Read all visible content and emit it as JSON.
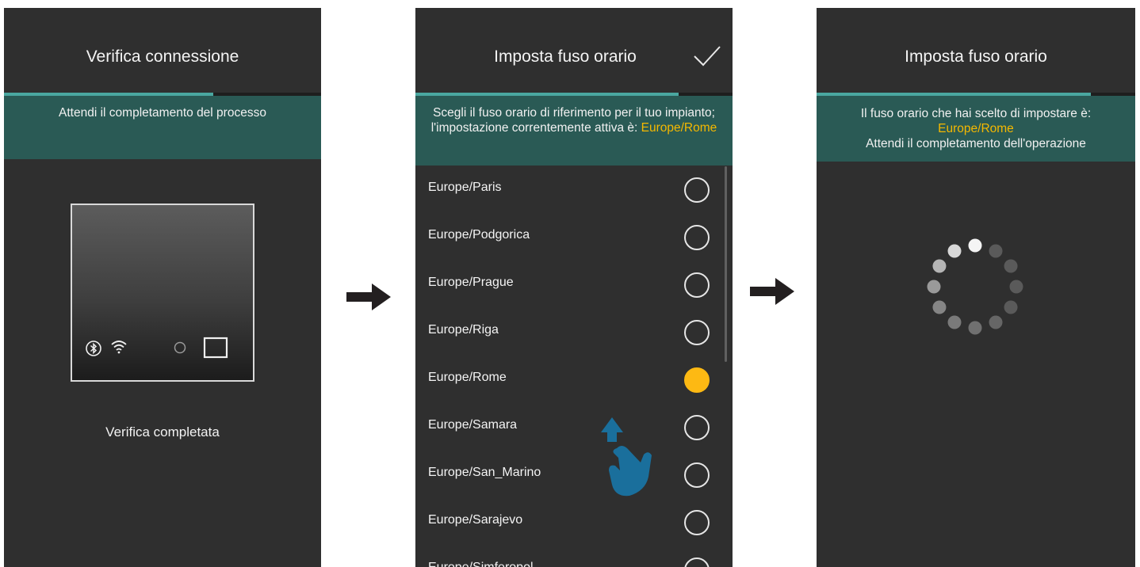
{
  "screen1": {
    "title": "Verifica connessione",
    "progress": 0.66,
    "banner": "Attendi il completamento del processo",
    "device_icons": [
      "bluetooth-icon",
      "wifi-icon",
      "led-dot-icon",
      "square-button-icon"
    ],
    "status": "Verifica completata"
  },
  "screen2": {
    "title": "Imposta fuso orario",
    "confirm_icon": "checkmark-icon",
    "progress": 0.83,
    "banner_text": "Scegli il fuso orario di riferimento per il tuo impianto; l'impostazione correntemente attiva è: ",
    "banner_value": "Europe/Rome",
    "timezones": [
      {
        "label": "Europe/Paris",
        "selected": false
      },
      {
        "label": "Europe/Podgorica",
        "selected": false
      },
      {
        "label": "Europe/Prague",
        "selected": false
      },
      {
        "label": "Europe/Riga",
        "selected": false
      },
      {
        "label": "Europe/Rome",
        "selected": true
      },
      {
        "label": "Europe/Samara",
        "selected": false
      },
      {
        "label": "Europe/San_Marino",
        "selected": false
      },
      {
        "label": "Europe/Sarajevo",
        "selected": false
      },
      {
        "label": "Europe/Simferopol",
        "selected": false
      }
    ],
    "gesture_icon": "swipe-up-hand-icon"
  },
  "screen3": {
    "title": "Imposta fuso orario",
    "progress": 0.86,
    "banner_line1": "Il fuso orario che hai scelto di impostare è:",
    "banner_value": "Europe/Rome",
    "banner_line3": "Attendi il completamento dell'operazione",
    "spinner_icon": "loading-spinner-icon"
  },
  "arrows": [
    "right-arrow-icon",
    "right-arrow-icon"
  ],
  "colors": {
    "screen_bg": "#2f2f2f",
    "banner_bg": "#2a5a55",
    "progress": "#4aa7a0",
    "highlight": "#f5b800",
    "selected_radio": "#fdb913",
    "hand": "#1a6f9c"
  }
}
